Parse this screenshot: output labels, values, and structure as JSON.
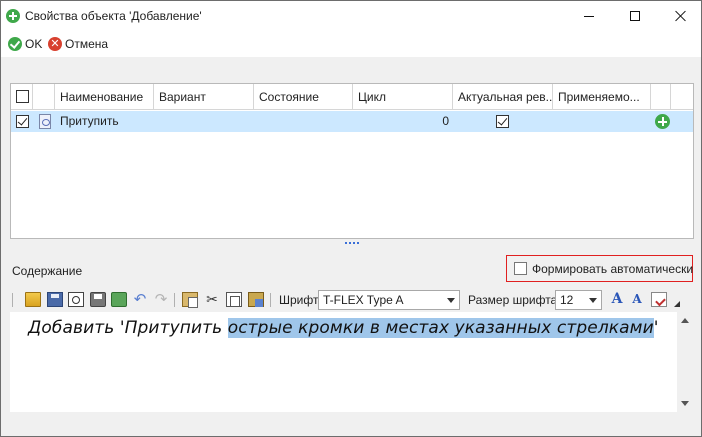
{
  "window": {
    "title": "Свойства объекта 'Добавление'"
  },
  "actions": {
    "ok_label": "OK",
    "cancel_label": "Отмена"
  },
  "grid": {
    "columns": [
      "Наименование",
      "Вариант",
      "Состояние",
      "Цикл",
      "Актуальная рев...",
      "Применяемо..."
    ],
    "rows": [
      {
        "checked": true,
        "name": "Притупить",
        "variant": "",
        "state": "",
        "cycle": "0",
        "actual_revision_checked": true,
        "applied": ""
      }
    ]
  },
  "content": {
    "label": "Содержание",
    "auto_checkbox_label": "Формировать автоматически",
    "auto_checked": false
  },
  "toolbar": {
    "font_label": "Шрифт",
    "font_value": "T-FLEX Type A",
    "size_label": "Размер шрифта",
    "size_value": "12"
  },
  "editor": {
    "text_plain": "Добавить 'Притупить ",
    "text_selected": "острые кромки в местах указанных стрелками",
    "text_after": "'"
  },
  "colors": {
    "selection_row": "#cce8ff",
    "accent_green": "#3fa84a",
    "cancel_red": "#d8412f",
    "highlight_border": "#e02020",
    "text_selection": "#9fc6ea"
  }
}
